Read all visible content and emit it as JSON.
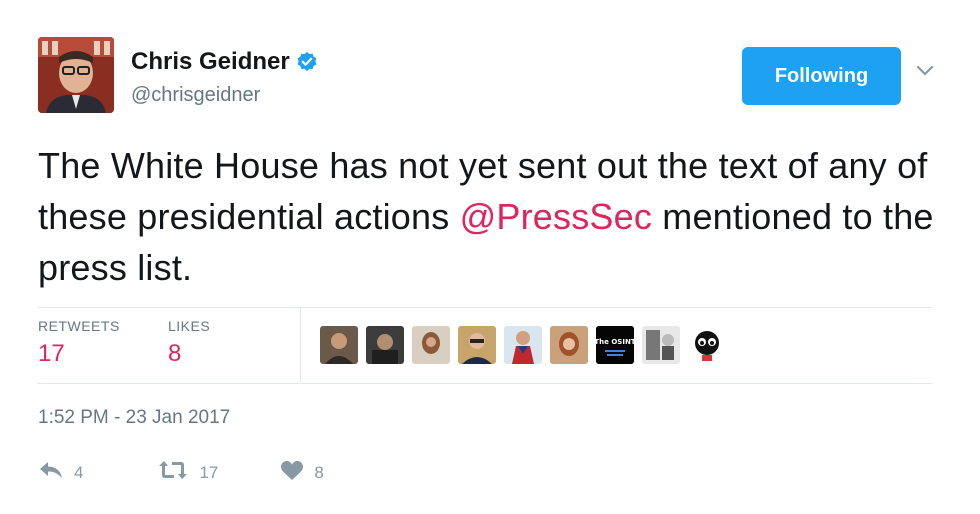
{
  "tweet": {
    "author": {
      "name": "Chris Geidner",
      "handle": "@chrisgeidner"
    },
    "follow_label": "Following",
    "text_part1": "The White House has not yet sent out the text of any of these presidential actions ",
    "mention": "@PressSec",
    "text_part2": " mentioned to the press list.",
    "stats": {
      "retweets_label": "RETWEETS",
      "retweets": "17",
      "likes_label": "LIKES",
      "likes": "8"
    },
    "liker_osint_label": "The OSINT",
    "timestamp": "1:52 PM - 23 Jan 2017",
    "actions": {
      "reply_count": "4",
      "retweet_count": "17",
      "like_count": "8"
    }
  },
  "colors": {
    "accent": "#1da1f2",
    "mention": "#e0245e",
    "secondary_text": "#657786"
  }
}
